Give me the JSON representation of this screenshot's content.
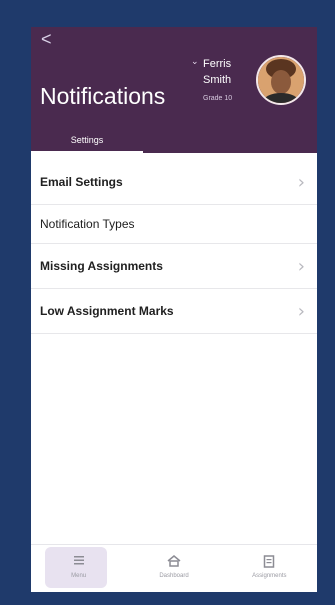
{
  "header": {
    "back_label": "<",
    "title": "Notifications",
    "user": {
      "name_line1": "Ferris",
      "name_line2": "Smith",
      "grade": "Grade 10",
      "dropdown_glyph": "⌄"
    },
    "tabs": [
      {
        "label": "Settings",
        "active": true
      }
    ]
  },
  "settings_list": {
    "items": [
      {
        "label": "Email Settings",
        "bold": true,
        "has_arrow": true
      },
      {
        "label": "Notification Types",
        "bold": false,
        "has_arrow": false
      },
      {
        "label": "Missing Assignments",
        "bold": true,
        "has_arrow": true
      },
      {
        "label": "Low Assignment Marks",
        "bold": true,
        "has_arrow": true
      }
    ],
    "arrow_glyph": "›"
  },
  "bottom_nav": {
    "items": [
      {
        "label": "Menu",
        "icon": "menu-icon",
        "active": true
      },
      {
        "label": "Dashboard",
        "icon": "home-icon",
        "active": false
      },
      {
        "label": "Assignments",
        "icon": "assignments-icon",
        "active": false
      }
    ]
  },
  "colors": {
    "background": "#1f3a6b",
    "header": "#4a2a4f",
    "active_nav_pill": "#e8e2f0"
  }
}
